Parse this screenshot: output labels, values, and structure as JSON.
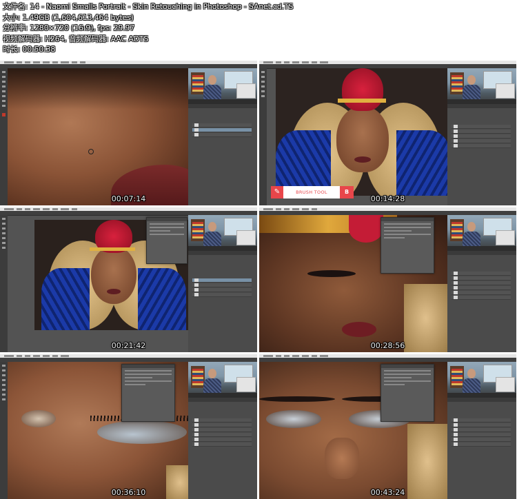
{
  "header": {
    "filename": "文件名: 14 - Naomi Smalls Portrait - Skin Retouching in Photoshop - SAnet.cd.TS",
    "size": "大小: 1.49GB (1,604,613,464 bytes)",
    "resolution": "分辨率: 1280×720 (16:9), fps: 29.97",
    "codec": "视频解码器: H264, 音频解码器: AAC ADTS",
    "duration": "时长: 00:50:38"
  },
  "thumbnails": [
    {
      "timestamp": "00:07:14",
      "scene": "skin-closeup-lips"
    },
    {
      "timestamp": "00:14:28",
      "scene": "full-portrait-brush-tool"
    },
    {
      "timestamp": "00:21:42",
      "scene": "full-portrait-with-panel"
    },
    {
      "timestamp": "00:28:56",
      "scene": "face-closeup-with-panel"
    },
    {
      "timestamp": "00:36:10",
      "scene": "eye-closeup-with-panel"
    },
    {
      "timestamp": "00:43:24",
      "scene": "eyes-closeup-with-panel"
    }
  ],
  "overlay": {
    "brush_tool_label": "BRUSH TOOL",
    "brush_tool_shortcut": "B",
    "brush_icon": "brush-icon"
  },
  "colors": {
    "ps_background": "#535353",
    "brush_accent": "#e8464a"
  }
}
